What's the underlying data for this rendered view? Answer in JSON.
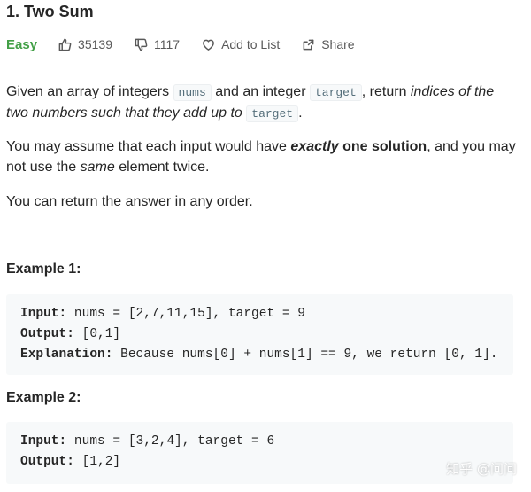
{
  "problem": {
    "title": "1. Two Sum",
    "difficulty": "Easy",
    "likes": "35139",
    "dislikes": "1117",
    "add_to_list": "Add to List",
    "share": "Share"
  },
  "description": {
    "p1": {
      "t1": "Given an array of integers ",
      "code1": "nums",
      "t2": " and an integer ",
      "code2": "target",
      "t3": ", return ",
      "em1": "indices of the two numbers such that they add up to",
      "t4": " ",
      "code3": "target",
      "t5": "."
    },
    "p2": {
      "t1": "You may assume that each input would have ",
      "strong_em": "exactly",
      "strong": " one solution",
      "t2": ", and you may not use the ",
      "em": "same",
      "t3": " element twice."
    },
    "p3": "You can return the answer in any order."
  },
  "examples": [
    {
      "title": "Example 1:",
      "input_label": "Input:",
      "input": " nums = [2,7,11,15], target = 9",
      "output_label": "Output:",
      "output": " [0,1]",
      "explanation_label": "Explanation:",
      "explanation": " Because nums[0] + nums[1] == 9, we return [0, 1]."
    },
    {
      "title": "Example 2:",
      "input_label": "Input:",
      "input": " nums = [3,2,4], target = 6",
      "output_label": "Output:",
      "output": " [1,2]"
    }
  ],
  "watermark": "知乎 @问问",
  "colors": {
    "easy": "#43a047",
    "text": "#262626",
    "muted": "#595959",
    "code_bg": "#f7f9fa"
  },
  "icons": [
    "thumbs-up-icon",
    "thumbs-down-icon",
    "heart-icon",
    "share-icon"
  ]
}
